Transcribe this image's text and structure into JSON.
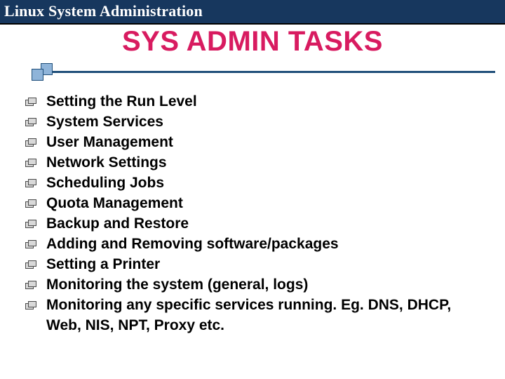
{
  "header": {
    "title": "Linux System Administration"
  },
  "main": {
    "title": "SYS ADMIN TASKS"
  },
  "tasks": [
    "Setting the Run Level",
    "System Services",
    "User Management",
    "Network Settings",
    "Scheduling Jobs",
    "Quota Management",
    "Backup and Restore",
    "Adding and Removing software/packages",
    "Setting a Printer",
    "Monitoring the system (general, logs)",
    "Monitoring any specific services running. Eg. DNS, DHCP, Web, NIS, NPT, Proxy etc."
  ]
}
